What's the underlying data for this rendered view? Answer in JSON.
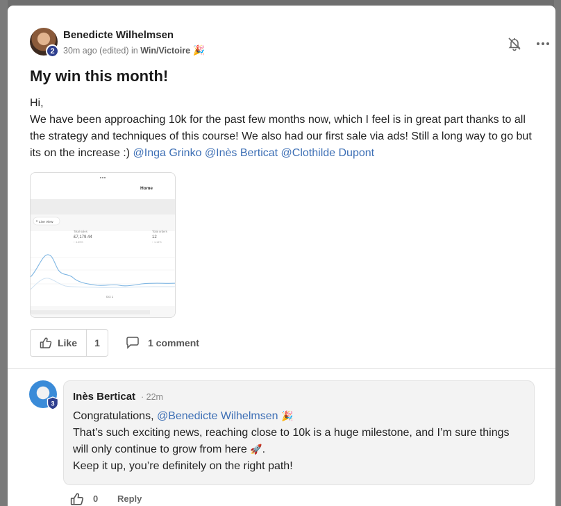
{
  "post": {
    "author": "Benedicte Wilhelmsen",
    "level": "2",
    "time": "30m ago (edited) in ",
    "category": "Win/Victoire",
    "category_emoji": "🎉",
    "title": "My win this month!",
    "body_greeting": "Hi,",
    "body_text": "We have been approaching 10k for the past few months now, which I feel is in great part thanks to all the strategy and techniques of this course! We also had our first sale via ads! Still a long way to go but its on the increase :) ",
    "mentions": [
      "@Inga Grinko",
      "@Inès Berticat",
      "@Clothilde Dupont"
    ],
    "attachment": {
      "header": "Home",
      "live_view": "Live View",
      "total_sales_label": "Total sales",
      "total_sales_value": "£7,179.44",
      "total_sales_delta": "↑ 4.65%",
      "total_orders_label": "Total orders",
      "total_orders_value": "12",
      "total_orders_delta": "↑ 1.14%",
      "x_label": "Oct 1"
    },
    "like_label": "Like",
    "like_count": "1",
    "comment_label": "1 comment"
  },
  "comment": {
    "author": "Inès Berticat",
    "time": "· 22m",
    "level": "3",
    "line1_prefix": "Congratulations, ",
    "line1_mention": "@Benedicte Wilhelmsen",
    "line1_emoji": "🎉",
    "line2": "That’s such exciting news, reaching close to 10k is a huge milestone, and I’m sure things will only continue to grow from here ",
    "line2_emoji": "🚀",
    "line2_end": ".",
    "line3": "Keep it up, you’re definitely on the right path!",
    "like_count": "0",
    "reply_label": "Reply"
  },
  "icons": {
    "bell": "bell-off-icon",
    "more": "more-horizontal-icon",
    "like": "thumbs-up-icon",
    "comment": "comment-bubble-icon",
    "shield": "shield-badge-icon"
  },
  "colors": {
    "mention": "#3d6fb5",
    "level_badge": "#2e3f8f",
    "overlay": "#6e6e6e"
  }
}
